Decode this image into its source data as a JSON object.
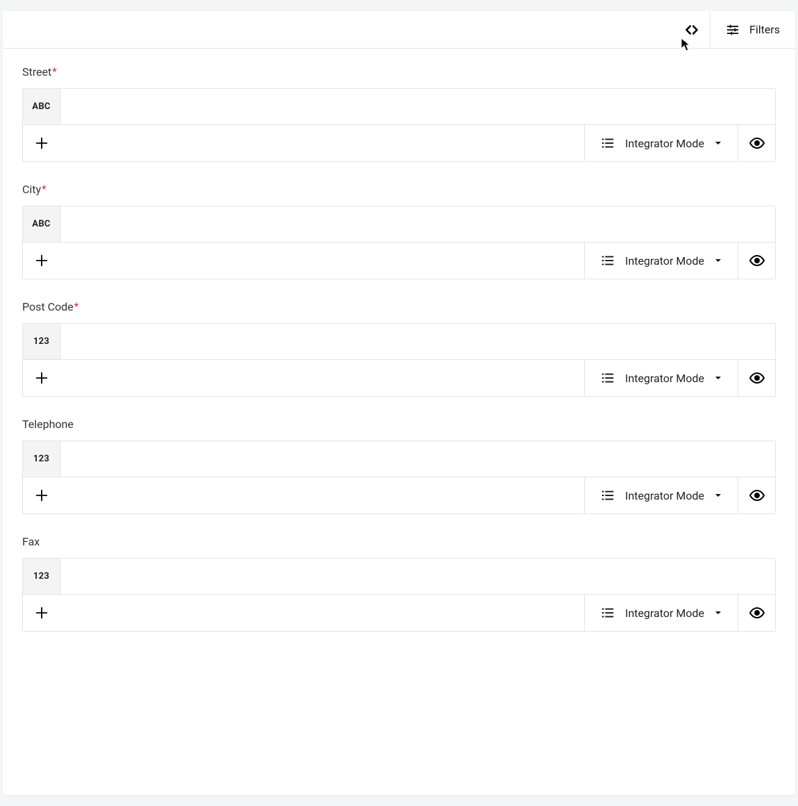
{
  "topbar": {
    "filters_label": "Filters"
  },
  "mode_label": "Integrator Mode",
  "fields": [
    {
      "label": "Street",
      "required": true,
      "type": "ABC"
    },
    {
      "label": "City",
      "required": true,
      "type": "ABC"
    },
    {
      "label": "Post Code",
      "required": true,
      "type": "123"
    },
    {
      "label": "Telephone",
      "required": false,
      "type": "123"
    },
    {
      "label": "Fax",
      "required": false,
      "type": "123"
    }
  ]
}
